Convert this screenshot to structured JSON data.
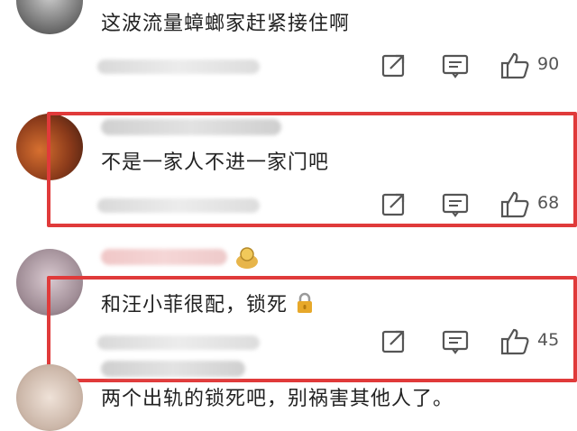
{
  "comments": [
    {
      "text": "这波流量蟑螂家赶紧接住啊",
      "likes": "90"
    },
    {
      "text": "不是一家人不进一家门吧",
      "likes": "68"
    },
    {
      "text": "和汪小菲很配，锁死",
      "likes": "45"
    },
    {
      "text": "两个出轨的锁死吧，别祸害其他人了。",
      "likes": ""
    }
  ],
  "colors": {
    "highlight": "#e03a3a",
    "icon": "#555555",
    "lock": "#e7a82a"
  },
  "icons": [
    "share-icon",
    "comment-icon",
    "thumb-up-icon",
    "lock-icon"
  ]
}
